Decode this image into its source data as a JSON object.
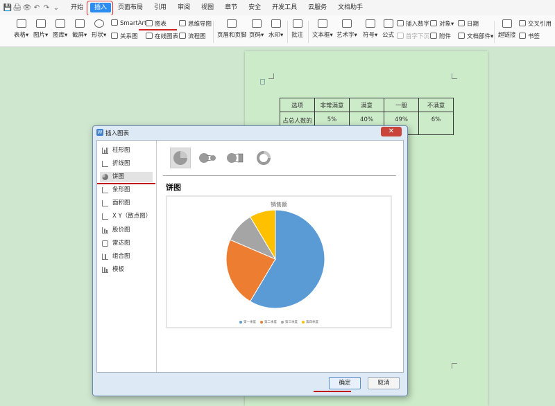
{
  "quick_access": [
    "💾",
    "🖨",
    "👁",
    "↶",
    "↷",
    "⌄"
  ],
  "menu": {
    "items": [
      "开始",
      "插入",
      "页面布局",
      "引用",
      "审阅",
      "视图",
      "章节",
      "安全",
      "开发工具",
      "云服务",
      "文档助手"
    ],
    "active_index": 1
  },
  "ribbon": {
    "table": "表格▾",
    "picture": "图片▾",
    "gallery": "图库▾",
    "screenshot": "截屏▾",
    "shape": "形状▾",
    "smartart": "SmartArt",
    "chart": "图表",
    "mindmap": "思维导图",
    "relation": "关系图",
    "online_chart": "在线图表",
    "flowchart": "流程图",
    "header_footer": "页眉和页脚",
    "page_number": "页码▾",
    "watermark": "水印▾",
    "comment": "批注",
    "textbox": "文本框▾",
    "wordart": "艺术字▾",
    "symbol": "符号▾",
    "formula": "公式",
    "insert_number": "插入数字",
    "first_drop": "首字下沉",
    "object": "对象▾",
    "attachment": "附件",
    "date": "日期",
    "doc_parts": "文档部件▾",
    "hyperlink": "超链接",
    "cross_ref": "交叉引用",
    "bookmark": "书签"
  },
  "doc_table": {
    "headers": [
      "选项",
      "非常满意",
      "满意",
      "一般",
      "不满意"
    ],
    "row": [
      "占总人数的",
      "5%",
      "40%",
      "49%",
      "6%"
    ]
  },
  "dialog": {
    "title": "插入图表",
    "close": "✕",
    "categories": [
      "柱形图",
      "折线图",
      "饼图",
      "条形图",
      "面积图",
      "X Y（散点图）",
      "股价图",
      "雷达图",
      "组合图",
      "模板"
    ],
    "selected_category_index": 2,
    "section_title": "饼图",
    "ok": "确定",
    "cancel": "取消"
  },
  "chart_data": {
    "type": "pie",
    "title": "销售额",
    "categories": [
      "第一季度",
      "第二季度",
      "第三季度",
      "第四季度"
    ],
    "values": [
      8.2,
      3.2,
      1.4,
      1.2
    ],
    "colors": [
      "#5b9bd5",
      "#ed7d31",
      "#a5a5a5",
      "#ffc000"
    ],
    "legend_position": "bottom"
  }
}
